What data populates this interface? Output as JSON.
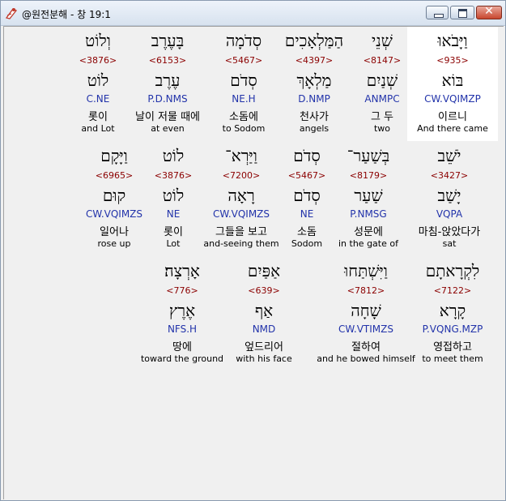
{
  "window": {
    "title": "@원전분해 - 창 19:1",
    "icon": "app-logo-icon",
    "close_glyph": "✕"
  },
  "rows": [
    {
      "cells": [
        {
          "hebrew": "וַיָּבֹאוּ",
          "strong": "<935>",
          "lemma": "בּוֹא",
          "morph": "CW.VQIMZP",
          "korean": "이르니",
          "english": "And there came",
          "highlight": true
        },
        {
          "hebrew": "שְׁנֵי",
          "strong": "<8147>",
          "lemma": "שְׁנַיִם",
          "morph": "ANMPC",
          "korean": "그 두",
          "english": "two"
        },
        {
          "hebrew": "הַמַּלְאָכִים",
          "strong": "<4397>",
          "lemma": "מַלְאָךְ",
          "morph": "D.NMP",
          "korean": "천사가",
          "english": "angels"
        },
        {
          "hebrew": "סְדֹמָה",
          "strong": "<5467>",
          "lemma": "סְדֹם",
          "morph": "NE.H",
          "korean": "소돔에",
          "english": "to Sodom"
        },
        {
          "hebrew": "בָּעֶרֶב",
          "strong": "<6153>",
          "lemma": "עֶרֶב",
          "morph": "P.D.NMS",
          "korean": "날이 저물 때에",
          "english": "at even"
        },
        {
          "hebrew": "וְלוֹט",
          "strong": "<3876>",
          "lemma": "לוֹט",
          "morph": "C.NE",
          "korean": "롯이",
          "english": "and Lot"
        }
      ]
    },
    {
      "cells": [
        {
          "hebrew": "יֹשֵׁב",
          "strong": "<3427>",
          "lemma": "יָשַׁב",
          "morph": "VQPA",
          "korean": "마침-앉았다가",
          "english": "sat"
        },
        {
          "hebrew": "בְּשַׁעַר־",
          "strong": "<8179>",
          "lemma": "שַׁעַר",
          "morph": "P.NMSG",
          "korean": "성문에",
          "english": "in the gate of"
        },
        {
          "hebrew": "סְדֹם",
          "strong": "<5467>",
          "lemma": "סְדֹם",
          "morph": "NE",
          "korean": "소돔",
          "english": "Sodom"
        },
        {
          "hebrew": "וַיַּרְא־",
          "strong": "<7200>",
          "lemma": "רָאָה",
          "morph": "CW.VQIMZS",
          "korean": "그들을 보고",
          "english": "and-seeing them"
        },
        {
          "hebrew": "לוֹט",
          "strong": "<3876>",
          "lemma": "לוֹט",
          "morph": "NE",
          "korean": "롯이",
          "english": "Lot"
        },
        {
          "hebrew": "וַיָּקָם",
          "strong": "<6965>",
          "lemma": "קוּם",
          "morph": "CW.VQIMZS",
          "korean": "일어나",
          "english": "rose up"
        }
      ]
    },
    {
      "cells": [
        {
          "hebrew": "לִקְרָאתָם",
          "strong": "<7122>",
          "lemma": "קָרָא",
          "morph": "P.VQNG.MZP",
          "korean": "영접하고",
          "english": "to meet them"
        },
        {
          "hebrew": "וַיִּשְׁתַּחוּ",
          "strong": "<7812>",
          "lemma": "שָׁחָה",
          "morph": "CW.VTIMZS",
          "korean": "절하여",
          "english": "and he bowed himself"
        },
        {
          "hebrew": "אַפַּיִם",
          "strong": "<639>",
          "lemma": "אַף",
          "morph": "NMD",
          "korean": "엎드리어",
          "english": "with his face"
        },
        {
          "hebrew": "אָרְצָה׃",
          "strong": "<776>",
          "lemma": "אֶרֶץ",
          "morph": "NFS.H",
          "korean": "땅에",
          "english": "toward the ground"
        }
      ]
    }
  ]
}
